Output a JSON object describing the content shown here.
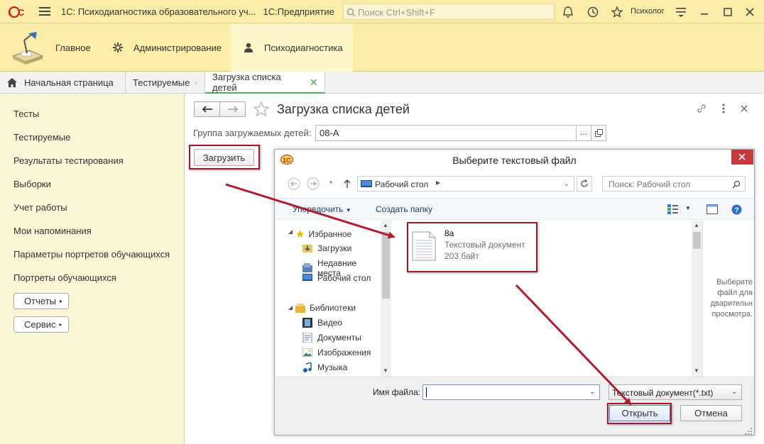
{
  "app": {
    "window_title": "1С: Психодиагностика образовательного уч...",
    "platform": "1С:Предприятие",
    "search_placeholder": "Поиск Ctrl+Shift+F",
    "user": "Психолог",
    "logo_text": "1С"
  },
  "sections": [
    {
      "label": "Главное"
    },
    {
      "label": "Администрирование"
    },
    {
      "label": "Психодиагностика"
    }
  ],
  "tabs": [
    {
      "label": "Начальная страница"
    },
    {
      "label": "Тестируемые"
    },
    {
      "label": "Загрузка списка детей"
    }
  ],
  "nav": {
    "items": [
      "Тесты",
      "Тестируемые",
      "Результаты тестирования",
      "Выборки",
      "Учет работы",
      "Мои напоминания",
      "Параметры портретов обучающихся",
      "Портреты обучающихся"
    ],
    "reports_btn": "Отчеты",
    "service_btn": "Сервис"
  },
  "form": {
    "title": "Загрузка списка детей",
    "group_label": "Группа загружаемых детей:",
    "group_value": "08-А",
    "load_button": "Загрузить",
    "ellipsis": "..."
  },
  "dialog": {
    "title": "Выберите текстовый файл",
    "address": "Рабочий стол",
    "search_placeholder": "Поиск: Рабочий стол",
    "organize": "Упорядочить",
    "new_folder": "Создать папку",
    "tree": {
      "favorites": "Избранное",
      "downloads": "Загрузки",
      "recent": "Недавние места",
      "desktop": "Рабочий стол",
      "libraries": "Библиотеки",
      "video": "Видео",
      "documents": "Документы",
      "images": "Изображения",
      "music": "Музыка"
    },
    "file": {
      "name": "8а",
      "type": "Текстовый документ",
      "size": "203 байт"
    },
    "preview_text": [
      "Выберите",
      "файл для",
      "дварительн",
      "просмотра."
    ],
    "filename_label": "Имя файла:",
    "filename_value": "",
    "filter": "Текстовый документ(*.txt)",
    "open_button": "Открыть",
    "cancel_button": "Отмена"
  },
  "colors": {
    "accent_yellow": "#fbeda7",
    "active_tab_underline": "#4caf50",
    "annotation_red": "#a01a2a",
    "close_red": "#c9383a"
  }
}
